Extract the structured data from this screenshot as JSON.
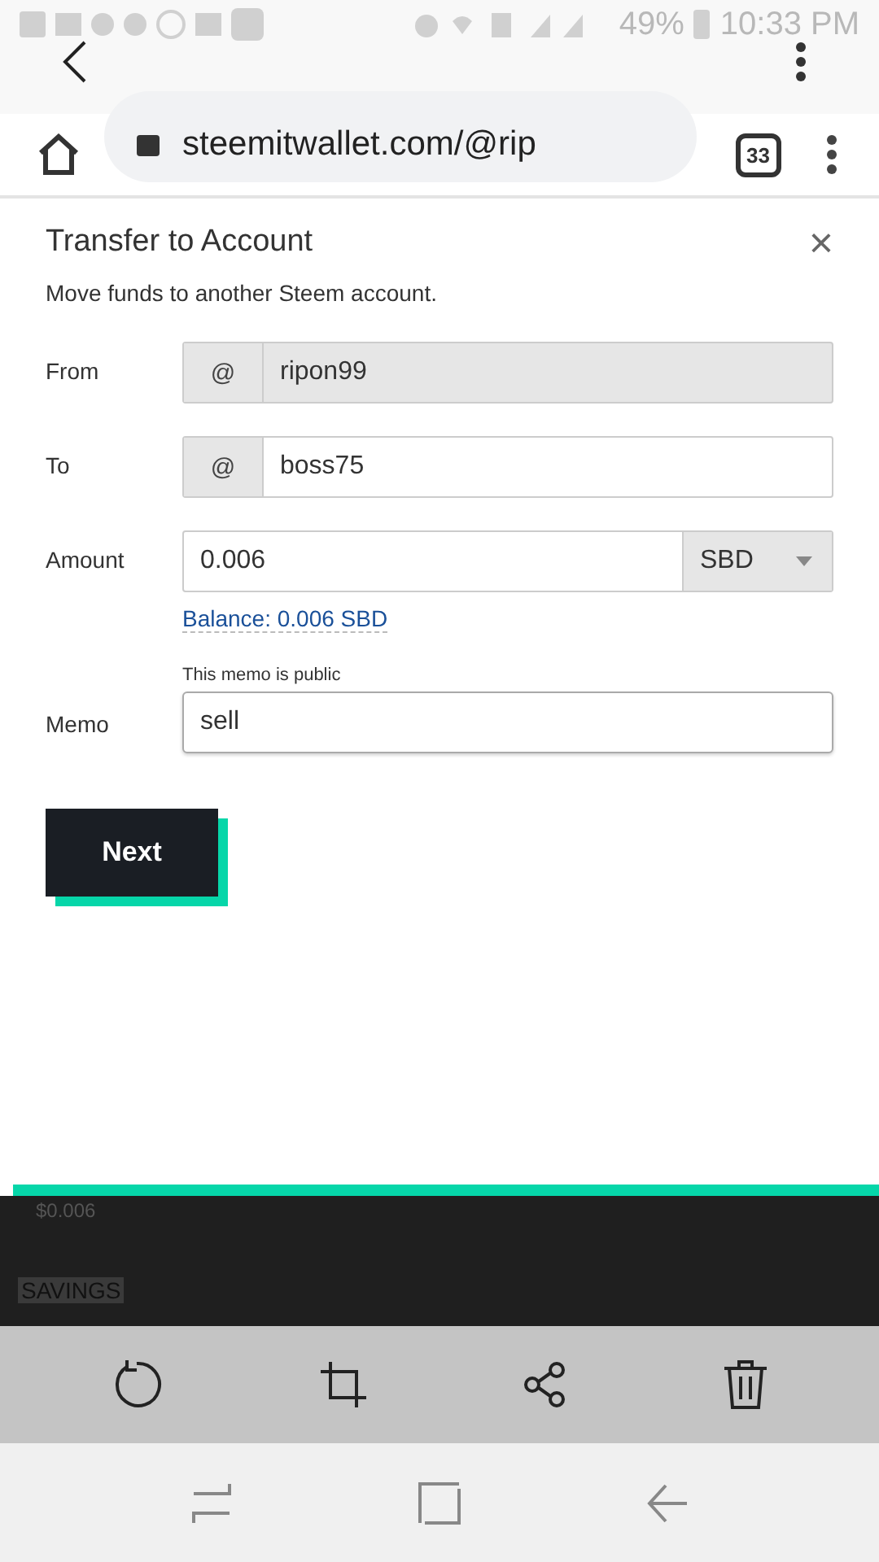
{
  "status_bar": {
    "battery": "49%",
    "time": "10:33 PM"
  },
  "browser": {
    "url": "steemitwallet.com/@rip",
    "tab_count": "33"
  },
  "dialog": {
    "title": "Transfer to Account",
    "subtitle": "Move funds to another Steem account.",
    "close": "×",
    "fields": [
      {
        "kind": "prefixed",
        "label": "From",
        "prefix": "@",
        "value": "ripon99",
        "disabled": true
      },
      {
        "kind": "prefixed",
        "label": "To",
        "prefix": "@",
        "value": "boss75",
        "disabled": false
      },
      {
        "kind": "amount",
        "label": "Amount",
        "value": "0.006",
        "currency": "SBD",
        "balance": "Balance: 0.006 SBD"
      },
      {
        "kind": "memo",
        "label": "Memo",
        "hint": "This memo is public",
        "value": "sell"
      }
    ],
    "next_button": "Next"
  },
  "background_page": {
    "amount": "$0.006",
    "section": "SAVINGS"
  }
}
